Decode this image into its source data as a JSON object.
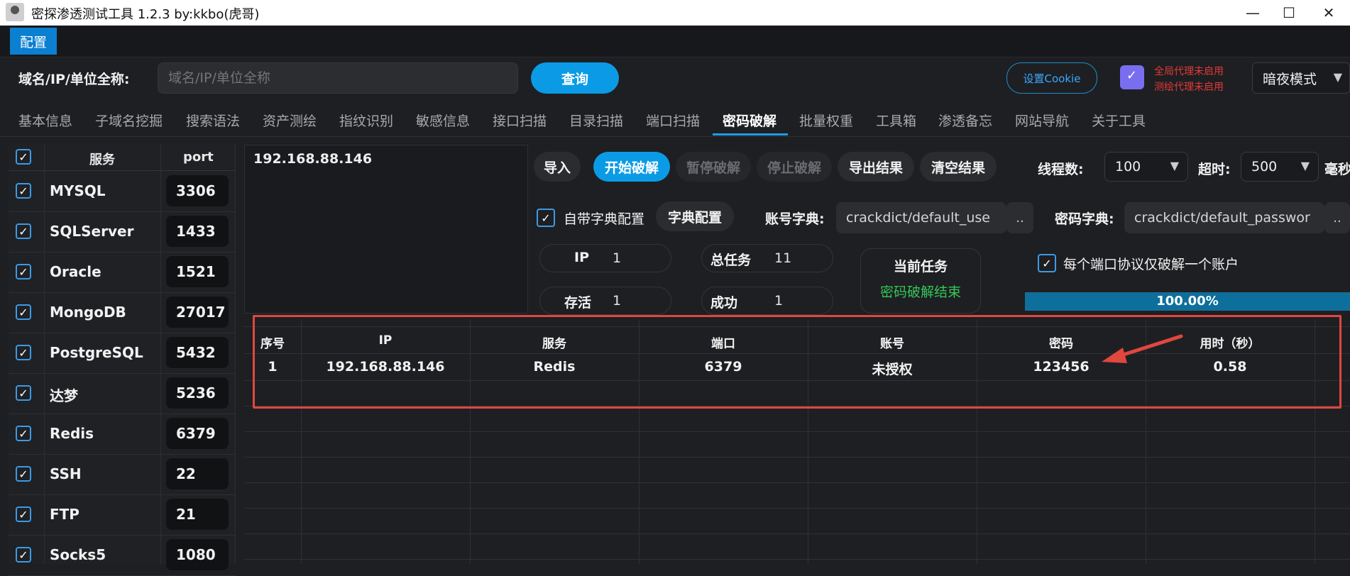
{
  "window": {
    "title": "密探渗透测试工具 1.2.3 by:kkbo(虎哥)",
    "minimize": "—",
    "maximize": "☐",
    "close": "✕"
  },
  "menu": {
    "config": "配置"
  },
  "query": {
    "label": "域名/IP/单位全称:",
    "placeholder": "域名/IP/单位全称",
    "button": "查询",
    "cookie_button": "设置Cookie",
    "proxy_global": "全局代理未启用",
    "proxy_mapping": "测绘代理未启用",
    "theme": "暗夜模式"
  },
  "tabs": [
    "基本信息",
    "子域名挖掘",
    "搜索语法",
    "资产测绘",
    "指纹识别",
    "敏感信息",
    "接口扫描",
    "目录扫描",
    "端口扫描",
    "密码破解",
    "批量权重",
    "工具箱",
    "渗透备忘",
    "网站导航",
    "关于工具"
  ],
  "active_tab": "密码破解",
  "services": {
    "header_service": "服务",
    "header_port": "port",
    "rows": [
      {
        "name": "MYSQL",
        "port": "3306",
        "checked": true
      },
      {
        "name": "SQLServer",
        "port": "1433",
        "checked": true
      },
      {
        "name": "Oracle",
        "port": "1521",
        "checked": true
      },
      {
        "name": "MongoDB",
        "port": "27017",
        "checked": true
      },
      {
        "name": "PostgreSQL",
        "port": "5432",
        "checked": true
      },
      {
        "name": "达梦",
        "port": "5236",
        "checked": true
      },
      {
        "name": "Redis",
        "port": "6379",
        "checked": true
      },
      {
        "name": "SSH",
        "port": "22",
        "checked": true
      },
      {
        "name": "FTP",
        "port": "21",
        "checked": true
      },
      {
        "name": "Socks5",
        "port": "1080",
        "checked": true
      }
    ]
  },
  "targets": "192.168.88.146",
  "controls": {
    "import": "导入",
    "start": "开始破解",
    "pause": "暂停破解",
    "stop": "停止破解",
    "export": "导出结果",
    "clear": "清空结果",
    "threads_label": "线程数:",
    "threads": "100",
    "timeout_label": "超时:",
    "timeout": "500",
    "timeout_unit": "毫秒",
    "builtin_dict": "自带字典配置",
    "dict_config": "字典配置",
    "user_dict_label": "账号字典:",
    "user_dict": "crackdict/default_use",
    "pass_dict_label": "密码字典:",
    "pass_dict": "crackdict/default_passwor",
    "browse": "..",
    "one_account": "每个端口协议仅破解一个账户"
  },
  "stats": {
    "ip_label": "IP",
    "ip": "1",
    "total_label": "总任务",
    "total": "11",
    "alive_label": "存活",
    "alive": "1",
    "success_label": "成功",
    "success": "1",
    "task_title": "当前任务",
    "task_status": "密码破解结束",
    "progress": 100,
    "progress_text": "100.00%"
  },
  "results": {
    "headers": [
      "序号",
      "IP",
      "服务",
      "端口",
      "账号",
      "密码",
      "用时（秒）"
    ],
    "rows": [
      [
        "1",
        "192.168.88.146",
        "Redis",
        "6379",
        "未授权",
        "123456",
        "0.58"
      ]
    ]
  },
  "colors": {
    "accent": "#0b9be6",
    "highlight": "#e0473e",
    "success": "#34c759"
  }
}
